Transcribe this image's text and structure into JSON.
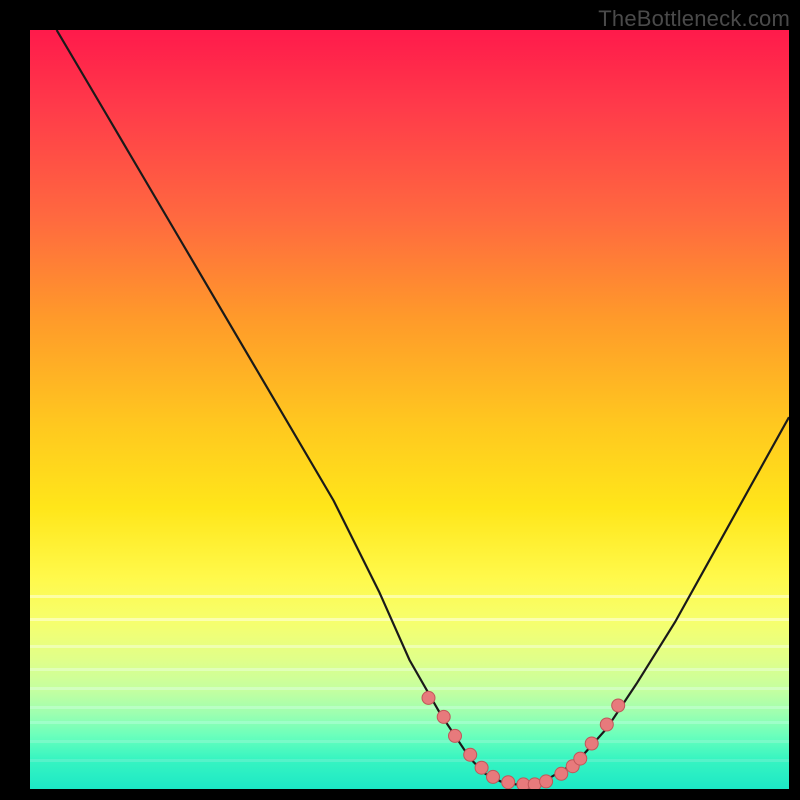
{
  "watermark": "TheBottleneck.com",
  "colors": {
    "page_bg": "#000000",
    "curve_stroke": "#1a1a1a",
    "point_fill": "#e77a7c",
    "point_stroke": "#c05659"
  },
  "chart_data": {
    "type": "line",
    "title": "",
    "subtitle": "",
    "xlabel": "",
    "ylabel": "",
    "xlim": [
      0,
      100
    ],
    "ylim": [
      0,
      100
    ],
    "grid": false,
    "legend": false,
    "series": [
      {
        "name": "curve",
        "x": [
          3.5,
          10,
          20,
          30,
          40,
          46,
          50,
          54,
          58,
          60,
          62,
          64,
          66,
          68,
          72,
          76,
          80,
          85,
          90,
          95,
          100
        ],
        "y": [
          100,
          89,
          72,
          55,
          38,
          26,
          17,
          10,
          4,
          2,
          1,
          0.6,
          0.6,
          1.2,
          3.5,
          8,
          14,
          22,
          31,
          40,
          49
        ]
      }
    ],
    "highlight_points": {
      "name": "dots",
      "x": [
        52.5,
        54.5,
        56.0,
        58.0,
        59.5,
        61.0,
        63.0,
        65.0,
        66.5,
        68.0,
        70.0,
        71.5,
        72.5,
        74.0,
        76.0,
        77.5
      ],
      "y": [
        12.0,
        9.5,
        7.0,
        4.5,
        2.8,
        1.6,
        0.9,
        0.6,
        0.6,
        1.0,
        2.0,
        3.0,
        4.0,
        6.0,
        8.5,
        11.0
      ]
    },
    "gradient_stops": [
      {
        "pos": 0.0,
        "color": "#ff1a4b"
      },
      {
        "pos": 0.1,
        "color": "#ff3a4a"
      },
      {
        "pos": 0.25,
        "color": "#ff6a3f"
      },
      {
        "pos": 0.38,
        "color": "#ff9a2a"
      },
      {
        "pos": 0.52,
        "color": "#ffc81f"
      },
      {
        "pos": 0.63,
        "color": "#ffe61a"
      },
      {
        "pos": 0.72,
        "color": "#fff94a"
      },
      {
        "pos": 0.78,
        "color": "#f6ff6e"
      },
      {
        "pos": 0.83,
        "color": "#e0ff8a"
      },
      {
        "pos": 0.87,
        "color": "#c4ffa0"
      },
      {
        "pos": 0.9,
        "color": "#9effb0"
      },
      {
        "pos": 0.93,
        "color": "#6affbc"
      },
      {
        "pos": 0.96,
        "color": "#38f5c1"
      },
      {
        "pos": 1.0,
        "color": "#1ce8c6"
      }
    ]
  }
}
